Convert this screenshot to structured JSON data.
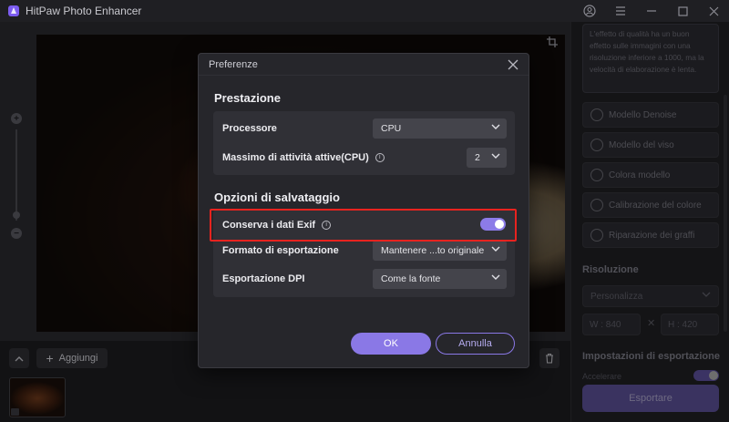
{
  "app": {
    "title": "HitPaw Photo Enhancer",
    "accent_color": "#8a78e6",
    "highlight_color": "#e8231f"
  },
  "toolbar": {
    "add_label": "Aggiungi"
  },
  "right_panel": {
    "info_text": "L'effetto di qualità ha un buon effetto sulle immagini con una risoluzione inferiore a 1000, ma la velocità di elaborazione è lenta.",
    "models": [
      {
        "label": "Modello Denoise",
        "icon": "denoise-icon"
      },
      {
        "label": "Modello del viso",
        "icon": "face-icon"
      },
      {
        "label": "Colora modello",
        "icon": "colorize-icon"
      },
      {
        "label": "Calibrazione del colore",
        "icon": "color-calibration-icon"
      },
      {
        "label": "Riparazione dei graffi",
        "icon": "scratch-repair-icon"
      }
    ],
    "resolution_title": "Risoluzione",
    "resolution_select": "Personalizza",
    "width_value": "W : 840",
    "height_value": "H : 420",
    "dim_separator": "✕",
    "export_settings_title": "Impostazioni di esportazione",
    "accelerate_label": "Accelerare",
    "accelerate_on": true,
    "export_button": "Esportare"
  },
  "dialog": {
    "title": "Preferenze",
    "performance": {
      "title": "Prestazione",
      "processor_label": "Processore",
      "processor_value": "CPU",
      "max_tasks_label": "Massimo di attività attive(CPU)",
      "max_tasks_value": "2"
    },
    "save_options": {
      "title": "Opzioni di salvataggio",
      "exif_label": "Conserva i dati Exif",
      "exif_enabled": true,
      "export_format_label": "Formato di esportazione",
      "export_format_value": "Mantenere ...to originale",
      "dpi_label": "Esportazione DPI",
      "dpi_value": "Come la fonte"
    },
    "ok_label": "OK",
    "cancel_label": "Annulla"
  }
}
